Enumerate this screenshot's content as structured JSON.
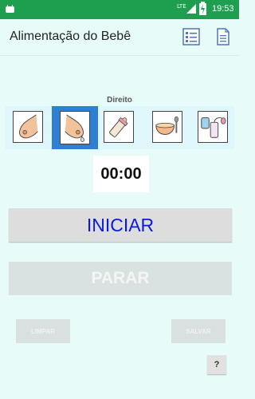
{
  "status_bar": {
    "network": "LTE",
    "battery_level": "9",
    "time": "19:53"
  },
  "app_bar": {
    "title": "Alimentação do Bebê",
    "icons": [
      "list-icon",
      "document-icon"
    ]
  },
  "feeding": {
    "side_label": "Direito",
    "options": [
      {
        "name": "left-breast-icon",
        "selected": false
      },
      {
        "name": "right-breast-icon",
        "selected": true
      },
      {
        "name": "bottle-icon",
        "selected": false
      },
      {
        "name": "food-bowl-icon",
        "selected": false
      },
      {
        "name": "breast-pump-icon",
        "selected": false
      }
    ],
    "timer": "00:00"
  },
  "buttons": {
    "start": "INICIAR",
    "stop": "PARAR",
    "clear": "LIMPAR",
    "save": "SALVAR",
    "help": "?"
  },
  "colors": {
    "status_bar": "#1d9f4f",
    "background": "#e7fbf8",
    "selected": "#2e80d4",
    "start_text": "#0a1ae0"
  }
}
